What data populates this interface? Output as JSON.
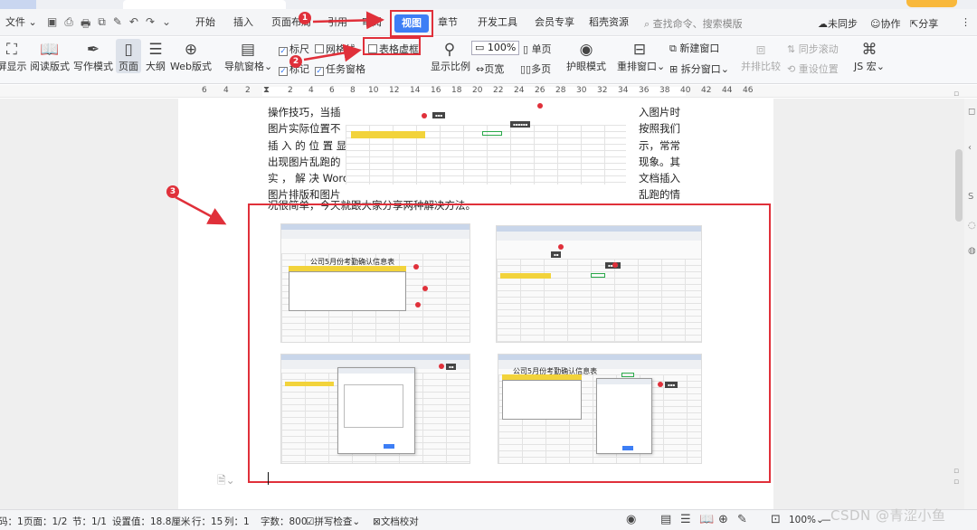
{
  "tabs": {
    "t1": "",
    "t2": "",
    "t3": ""
  },
  "menu": {
    "file": "文件",
    "start": "开始",
    "insert": "插入",
    "layout": "页面布局",
    "references": "引用",
    "review": "审阅",
    "view": "视图",
    "chapter": "章节",
    "developer": "开发工具",
    "member": "会员专享",
    "resources": "稻壳资源",
    "search": "查找命令、搜索模版",
    "unsync": "未同步",
    "collab": "协作",
    "share": "分享"
  },
  "toolbar": {
    "full_screen": "屏显示",
    "read_mode": "阅读版式",
    "write_mode": "写作模式",
    "page": "页面",
    "outline": "大纲",
    "web": "Web版式",
    "nav_pane": "导航窗格",
    "ruler": "标尺",
    "gridlines": "网格线",
    "table_border": "表格虚框",
    "markup": "标记",
    "task_pane": "任务窗格",
    "show_ratio": "显示比例",
    "zoom_100": "100%",
    "single_page": "单页",
    "page_width": "页宽",
    "multi_page": "多页",
    "eye_mode": "护眼模式",
    "rearrange": "重排窗口",
    "new_window": "新建窗口",
    "split_window": "拆分窗口",
    "side_by_side": "并排比较",
    "sync_scroll": "同步滚动",
    "reset_pos": "重设位置",
    "js_macro": "JS 宏"
  },
  "ruler": [
    "6",
    "4",
    "2",
    "2",
    "4",
    "6",
    "8",
    "10",
    "12",
    "14",
    "16",
    "18",
    "20",
    "22",
    "24",
    "26",
    "28",
    "30",
    "32",
    "34",
    "36",
    "38",
    "40",
    "42",
    "44",
    "46"
  ],
  "doc": {
    "left_lines": [
      "操作技巧，当插",
      "图片实际位置不",
      "插 入 的 位 置 显",
      "出现图片乱跑的",
      "实 ， 解 决  Word",
      "图片排版和图片"
    ],
    "right_lines": [
      "入图片时",
      "按照我们",
      "示，常常",
      "现象。其",
      "文档插入",
      "乱跑的情"
    ],
    "last_line": "况很简单，今天就跟大家分享两种解决方法。",
    "screenshot_title": "公司5月份考勤确认信息表"
  },
  "annotations": {
    "n1": "1",
    "n2": "2",
    "n3": "3"
  },
  "status": {
    "page_num": "码：1",
    "pages": "页面：1/2",
    "section": "节：1/1",
    "setting": "设置值：18.8厘米",
    "row": "行：15",
    "col": "列：1",
    "words": "字数：800",
    "spell": "拼写检查",
    "proof": "文档校对",
    "zoom": "100%"
  },
  "watermark": "CSDN @青涩小鱼",
  "colors": {
    "accent": "#3d7ef5",
    "annotation": "#e0303a",
    "highlight": "#f2d33b"
  }
}
